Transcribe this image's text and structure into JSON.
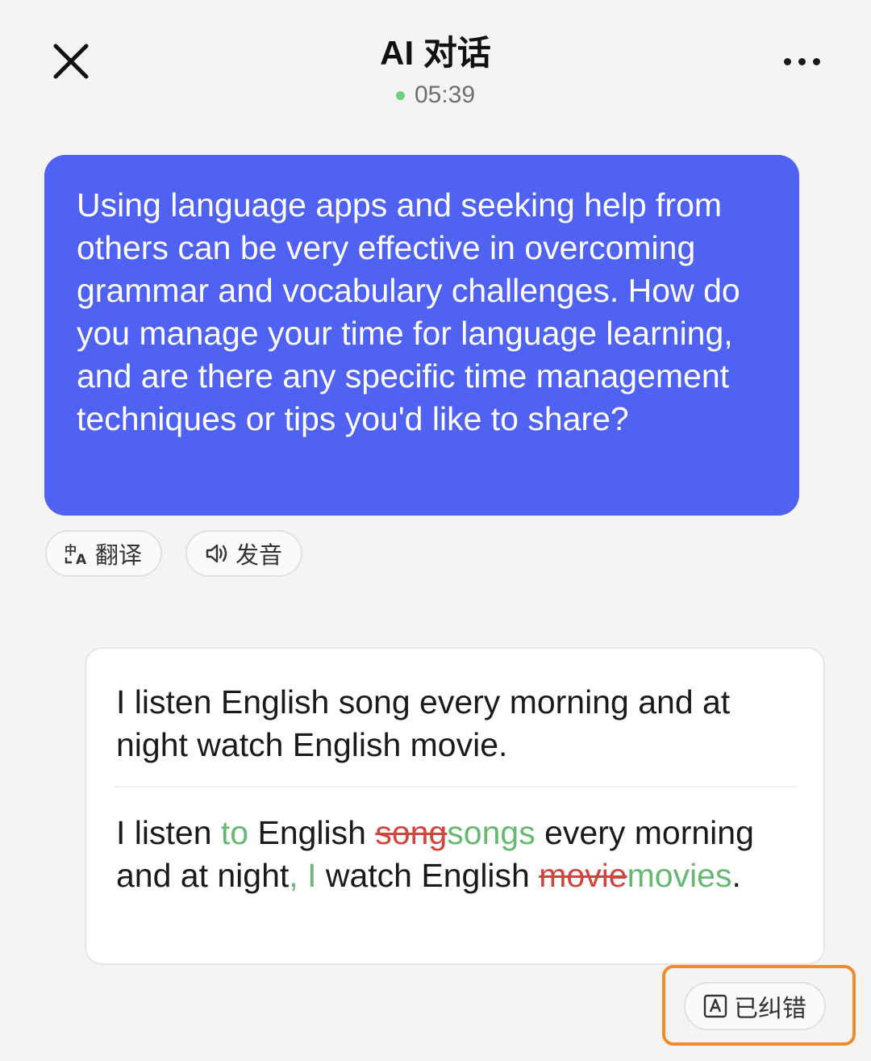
{
  "header": {
    "title": "AI 对话",
    "timer": "05:39",
    "status_color": "#6dd27a"
  },
  "ai_message": {
    "text": "Using language apps and seeking help from others can be very effective in overcoming grammar and vocabulary challenges. How do you manage your time for language learning, and are there any specific time management techniques or tips you'd like to share?",
    "bubble_color": "#5062f2"
  },
  "actions": {
    "translate_label": "翻译",
    "translate_icon": "translate-icon",
    "speak_label": "发音",
    "speak_icon": "speaker-icon"
  },
  "user_message": {
    "original": "I listen English song every morning and at night watch English movie.",
    "corrected_segments": [
      {
        "text": "I listen ",
        "type": "normal"
      },
      {
        "text": "to",
        "type": "added"
      },
      {
        "text": " English ",
        "type": "normal"
      },
      {
        "text": "song",
        "type": "deleted"
      },
      {
        "text": "songs",
        "type": "added"
      },
      {
        "text": " every morning and at night",
        "type": "normal"
      },
      {
        "text": ", I",
        "type": "added"
      },
      {
        "text": " watch English ",
        "type": "normal"
      },
      {
        "text": "movie",
        "type": "deleted"
      },
      {
        "text": "movies",
        "type": "added"
      },
      {
        "text": ".",
        "type": "normal"
      }
    ],
    "added_color": "#67b873",
    "deleted_color": "#d0453f"
  },
  "correction_badge": {
    "label": "已纠错",
    "icon": "font-check-icon",
    "highlight_color": "#f08a2a"
  }
}
